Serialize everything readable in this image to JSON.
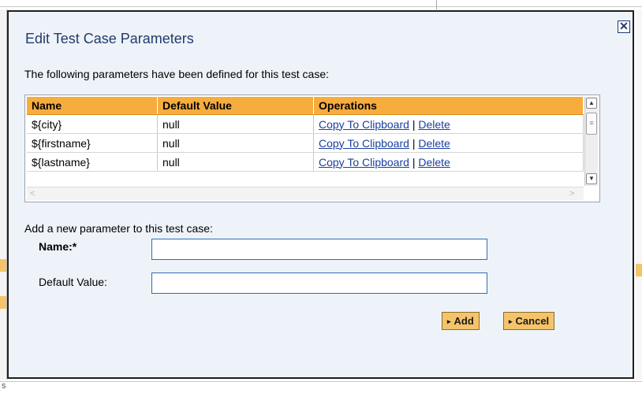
{
  "dialog": {
    "title": "Edit Test Case Parameters",
    "close_glyph": "✕",
    "intro": "The following parameters have been defined for this test case:"
  },
  "table": {
    "columns": [
      "Name",
      "Default Value",
      "Operations"
    ],
    "rows": [
      {
        "name": "${city}",
        "default": "null",
        "copy": "Copy To Clipboard",
        "sep": "|",
        "delete": "Delete"
      },
      {
        "name": "${firstname}",
        "default": "null",
        "copy": "Copy To Clipboard",
        "sep": "|",
        "delete": "Delete"
      },
      {
        "name": "${lastname}",
        "default": "null",
        "copy": "Copy To Clipboard",
        "sep": "|",
        "delete": "Delete"
      }
    ]
  },
  "form": {
    "heading": "Add a new parameter to this test case:",
    "name_label": "Name:*",
    "name_value": "",
    "default_label": "Default Value:",
    "default_value": ""
  },
  "buttons": {
    "add": "Add",
    "cancel": "Cancel",
    "triangle_glyph": "▸"
  },
  "background": {
    "bottom_fragment": "s"
  },
  "colors": {
    "header_orange": "#f7ac3e",
    "button_orange": "#f5c46a",
    "dialog_bg": "#eef3f9",
    "title_blue": "#1f3b6b",
    "link_blue": "#1a3fa0"
  },
  "icons": {
    "close": "close-icon",
    "scroll_up": "scroll-up-icon",
    "scroll_down": "scroll-down-icon",
    "scroll_left": "scroll-left-icon",
    "scroll_right": "scroll-right-icon"
  }
}
